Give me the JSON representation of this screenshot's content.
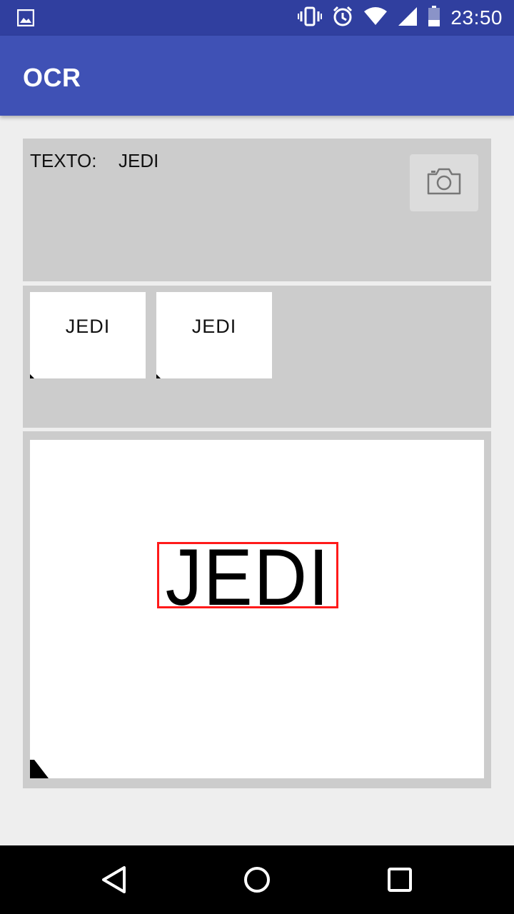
{
  "status_bar": {
    "time": "23:50",
    "icons": [
      "image-icon",
      "vibrate-icon",
      "alarm-icon",
      "wifi-icon",
      "signal-icon",
      "battery-icon"
    ]
  },
  "app_bar": {
    "title": "OCR"
  },
  "result": {
    "label": "TEXTO:",
    "value": "JEDI",
    "camera_button_icon": "camera-icon"
  },
  "thumbnails": [
    {
      "text": "JEDI"
    },
    {
      "text": "JEDI"
    }
  ],
  "preview": {
    "word": "JEDI",
    "box_color": "#ff1a1a"
  },
  "nav_bar": {
    "buttons": [
      "back-icon",
      "home-icon",
      "recents-icon"
    ]
  },
  "colors": {
    "primary": "#3f51b5",
    "primary_dark": "#303f9f",
    "panel": "#cccccc",
    "background": "#eeeeee"
  }
}
